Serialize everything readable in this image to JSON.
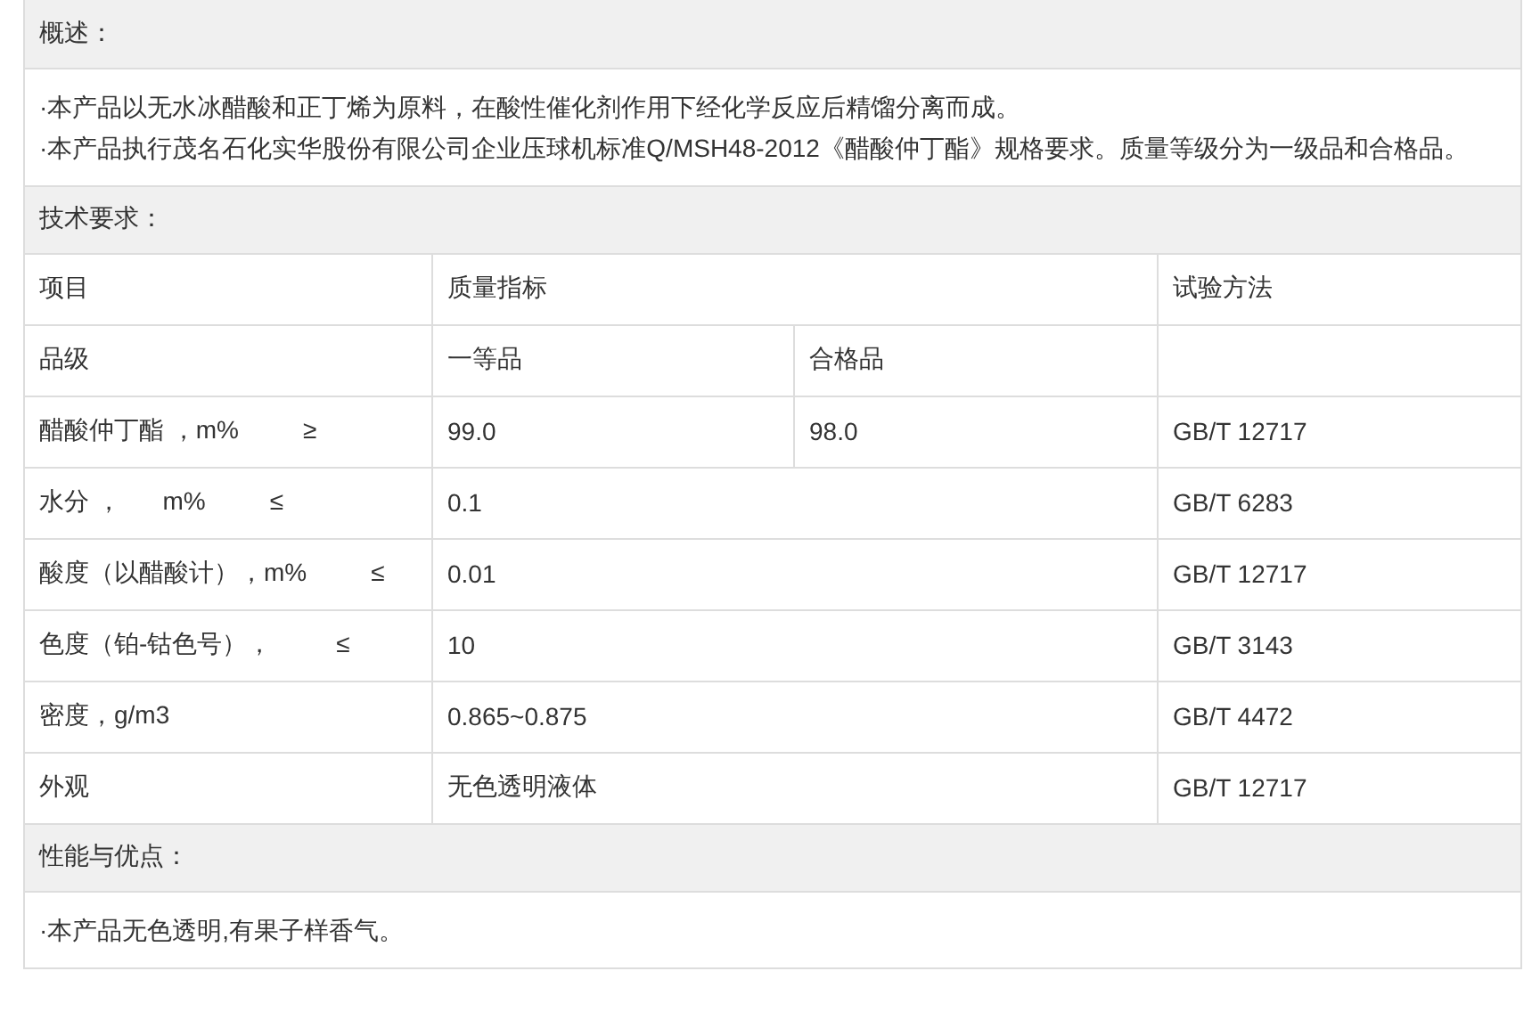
{
  "overview": {
    "heading": "概述：",
    "lines": [
      "·本产品以无水冰醋酸和正丁烯为原料，在酸性催化剂作用下经化学反应后精馏分离而成。",
      "·本产品执行茂名石化实华股份有限公司企业压球机标准Q/MSH48-2012《醋酸仲丁酯》规格要求。质量等级分为一级品和合格品。"
    ]
  },
  "tech": {
    "heading": "技术要求：",
    "header": {
      "item": "项目",
      "quality": "质量指标",
      "method": "试验方法"
    },
    "grade_row": {
      "item": "品级",
      "grades": [
        "一等品",
        "合格品"
      ]
    },
    "rows": [
      {
        "item": "醋酸仲丁酯 ，m%",
        "sign": "≥",
        "values": [
          "99.0",
          "98.0"
        ],
        "method": "GB/T 12717"
      },
      {
        "item": "水分 ，      m%",
        "sign": "≤",
        "values": [
          "0.1"
        ],
        "method": "GB/T 6283"
      },
      {
        "item": "酸度（以醋酸计），m%",
        "sign": "≤",
        "values": [
          "0.01"
        ],
        "method": "GB/T 12717"
      },
      {
        "item": "色度（铂-钴色号），",
        "sign": "≤",
        "values": [
          "10"
        ],
        "method": "GB/T 3143"
      },
      {
        "item": "密度，g/m3",
        "values": [
          "0.865~0.875"
        ],
        "method": "GB/T 4472"
      },
      {
        "item": "外观",
        "values": [
          "无色透明液体"
        ],
        "method": "GB/T 12717"
      }
    ]
  },
  "performance": {
    "heading": "性能与优点：",
    "lines": [
      "·本产品无色透明,有果子样香气。"
    ]
  }
}
